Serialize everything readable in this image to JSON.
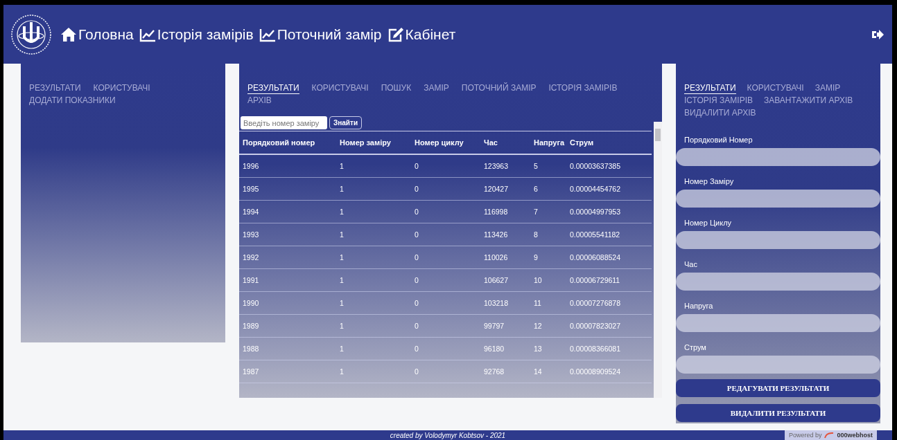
{
  "header": {
    "nav": [
      {
        "label": "Головна",
        "kind": "home"
      },
      {
        "label": "Історія замірів",
        "kind": "chart"
      },
      {
        "label": "Поточний замір",
        "kind": "chart"
      },
      {
        "label": "Кабінет",
        "kind": "edit"
      }
    ]
  },
  "left_panel": {
    "tabs": [
      {
        "label": "РЕЗУЛЬТАТИ",
        "selected": false
      },
      {
        "label": "КОРИСТУВАЧІ",
        "selected": false
      },
      {
        "label": "ДОДАТИ ПОКАЗНИКИ",
        "selected": false
      }
    ]
  },
  "center_panel": {
    "tabs": [
      {
        "label": "РЕЗУЛЬТАТИ",
        "selected": true
      },
      {
        "label": "КОРИСТУВАЧІ",
        "selected": false
      },
      {
        "label": "ПОШУК",
        "selected": false
      },
      {
        "label": "ЗАМІР",
        "selected": false
      },
      {
        "label": "ПОТОЧНИЙ ЗАМІР",
        "selected": false
      },
      {
        "label": "ІСТОРІЯ ЗАМІРІВ",
        "selected": false
      },
      {
        "label": "АРХІВ",
        "selected": false
      }
    ],
    "search": {
      "placeholder": "Введіть номер заміру",
      "button": "Знайти"
    },
    "table": {
      "columns": [
        "Порядковий номер",
        "Номер заміру",
        "Номер циклу",
        "Час",
        "Напруга",
        "Струм"
      ],
      "rows": [
        [
          "1996",
          "1",
          "0",
          "123963",
          "5",
          "0.00003637385"
        ],
        [
          "1995",
          "1",
          "0",
          "120427",
          "6",
          "0.00004454762"
        ],
        [
          "1994",
          "1",
          "0",
          "116998",
          "7",
          "0.00004997953"
        ],
        [
          "1993",
          "1",
          "0",
          "113426",
          "8",
          "0.00005541182"
        ],
        [
          "1992",
          "1",
          "0",
          "110026",
          "9",
          "0.00006088524"
        ],
        [
          "1991",
          "1",
          "0",
          "106627",
          "10",
          "0.00006729611"
        ],
        [
          "1990",
          "1",
          "0",
          "103218",
          "11",
          "0.00007276878"
        ],
        [
          "1989",
          "1",
          "0",
          "99797",
          "12",
          "0.00007823027"
        ],
        [
          "1988",
          "1",
          "0",
          "96180",
          "13",
          "0.00008366081"
        ],
        [
          "1987",
          "1",
          "0",
          "92768",
          "14",
          "0.00008909524"
        ]
      ]
    }
  },
  "right_panel": {
    "tabs": [
      {
        "label": "РЕЗУЛЬТАТИ",
        "selected": true
      },
      {
        "label": "КОРИСТУВАЧІ",
        "selected": false
      },
      {
        "label": "ЗАМІР",
        "selected": false
      },
      {
        "label": "ІСТОРІЯ ЗАМІРІВ",
        "selected": false
      },
      {
        "label": "ЗАВАНТАЖИТИ АРХІВ",
        "selected": false
      },
      {
        "label": "ВИДАЛИТИ АРХІВ",
        "selected": false
      }
    ],
    "fields": [
      {
        "label": "Порядковий Номер"
      },
      {
        "label": "Номер Заміру"
      },
      {
        "label": "Номер Циклу"
      },
      {
        "label": "Час"
      },
      {
        "label": "Напруга"
      },
      {
        "label": "Струм"
      }
    ],
    "buttons": [
      "РЕДАГУВАТИ РЕЗУЛЬТАТИ",
      "ВИДАЛИТИ РЕЗУЛЬТАТИ"
    ]
  },
  "footer": {
    "credit": "created by Volodymyr Kobtsov - 2021",
    "powered_by": "Powered by",
    "host": "000webhost"
  }
}
